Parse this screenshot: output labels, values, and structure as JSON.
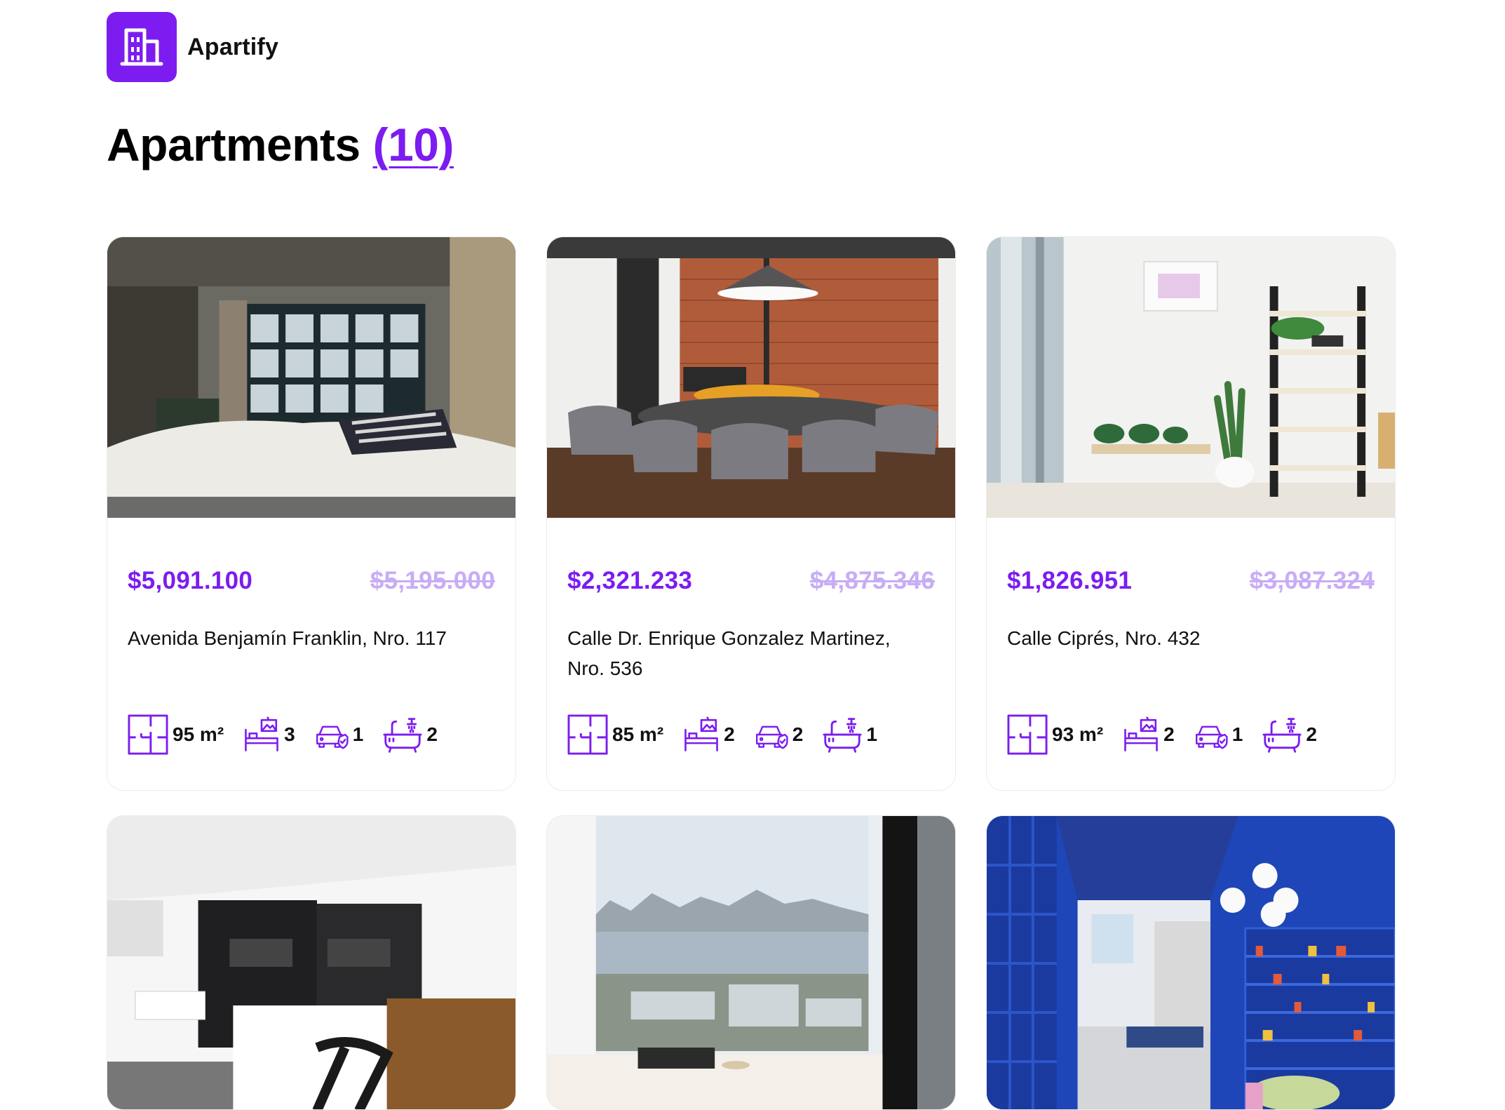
{
  "brand": {
    "name": "Apartify",
    "logo_icon": "building-icon",
    "accent": "#7c1cf0"
  },
  "page": {
    "title": "Apartments",
    "count": "(10)"
  },
  "listings": [
    {
      "price": "$5,091.100",
      "old_price": "$5,195.000",
      "address": "Avenida Benjamín Franklin, Nro. 117",
      "area": "95 m²",
      "bedrooms": "3",
      "parking": "1",
      "bathrooms": "2",
      "photo": "bedroom-loft"
    },
    {
      "price": "$2,321.233",
      "old_price": "$4,875.346",
      "address": "Calle Dr. Enrique Gonzalez Martinez, Nro. 536",
      "area": "85 m²",
      "bedrooms": "2",
      "parking": "2",
      "bathrooms": "1",
      "photo": "dining-brick-wall"
    },
    {
      "price": "$1,826.951",
      "old_price": "$3,087.324",
      "address": "Calle Ciprés, Nro. 432",
      "area": "93 m²",
      "bedrooms": "2",
      "parking": "1",
      "bathrooms": "2",
      "photo": "white-living-shelves"
    },
    {
      "photo": "modern-kitchen"
    },
    {
      "photo": "city-window-view"
    },
    {
      "photo": "blue-playroom"
    }
  ]
}
